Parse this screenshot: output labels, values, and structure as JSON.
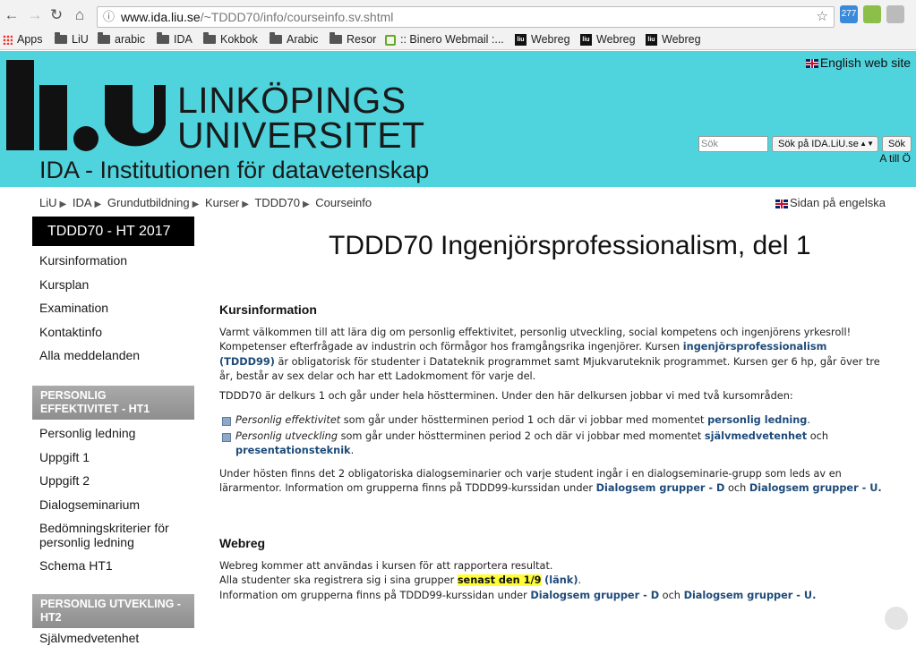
{
  "browser": {
    "url_host": "www.ida.liu.se",
    "url_path": "/~TDDD70/info/courseinfo.sv.shtml",
    "ext_badge": "277",
    "bookmarks": [
      "Apps",
      "LiU",
      "arabic",
      "IDA",
      "Kokbok",
      "Arabic",
      "Resor",
      ":: Binero Webmail :...",
      "Webreg",
      "Webreg",
      "Webreg"
    ]
  },
  "banner": {
    "logo_line1": "LINKÖPINGS",
    "logo_line2": "UNIVERSITET",
    "department": "IDA - Institutionen för datavetenskap",
    "english_site": "English web site",
    "search_placeholder": "Sök",
    "search_scope": "Sök på IDA.LiU.se",
    "search_button": "Sök",
    "a_to_z": "A till Ö"
  },
  "breadcrumb": [
    "LiU",
    "IDA",
    "Grundutbildning",
    "Kurser",
    "TDDD70",
    "Courseinfo"
  ],
  "page_en": "Sidan på engelska",
  "sidebar": {
    "course": "TDDD70 - HT 2017",
    "items": [
      "Kursinformation",
      "Kursplan",
      "Examination",
      "Kontaktinfo",
      "Alla meddelanden"
    ],
    "section1": "PERSONLIG EFFEKTIVITET - HT1",
    "section1_items": [
      "Personlig ledning",
      "Uppgift 1",
      "Uppgift 2",
      "Dialogseminarium",
      "Bedömningskriterier för personlig ledning",
      "Schema HT1"
    ],
    "section2": "PERSONLIG UTVEKLING - HT2",
    "section2_items": [
      "Självmedvetenhet"
    ]
  },
  "main": {
    "title": "TDDD70 Ingenjörsprofessionalism, del 1",
    "h_kurs": "Kursinformation",
    "p1a": "Varmt välkommen till att lära dig om personlig effektivitet, personlig utveckling, social kompetens och ingenjörens yrkesroll! Kompetenser efterfrågade av industrin och förmågor hos framgångsrika ingenjörer. Kursen ",
    "p1_link": "ingenjörsprofessionalism (TDDD99)",
    "p1b": " är obligatorisk för studenter i Datateknik programmet samt Mjukvaruteknik programmet. Kursen ger 6 hp, går över tre år, består av sex delar och har ett Ladokmoment för varje del.",
    "p2": "TDDD70 är delkurs 1 och går under hela höstterminen. Under den här delkursen jobbar vi med två kursområden:",
    "b1_em": "Personlig effektivitet",
    "b1_text": " som går under höstterminen period 1 och där vi jobbar med momentet ",
    "b1_link": "personlig ledning",
    "b2_em": "Personlig utveckling",
    "b2_text": " som går under höstterminen period 2 och där vi jobbar med momentet ",
    "b2_link1": "självmedvetenhet",
    "b2_mid": " och ",
    "b2_link2": "presentationsteknik",
    "p3a": "Under hösten finns det 2 obligatoriska dialogseminarier och varje student ingår i en dialogseminarie-grupp som leds av en lärarmentor. Information om grupperna finns på TDDD99-kurssidan under ",
    "link_dlg_d": "Dialogsem grupper - D",
    "och": " och ",
    "link_dlg_u": "Dialogsem grupper - U.",
    "h_webreg": "Webreg",
    "w1": "Webreg kommer att användas i kursen för att rapportera resultat.",
    "w2a": "Alla studenter ska registrera sig i sina grupper ",
    "w2_hl": "senast den 1/9",
    "w2_link": "(länk)",
    "w3a": "Information om grupperna finns på TDDD99-kurssidan under "
  }
}
